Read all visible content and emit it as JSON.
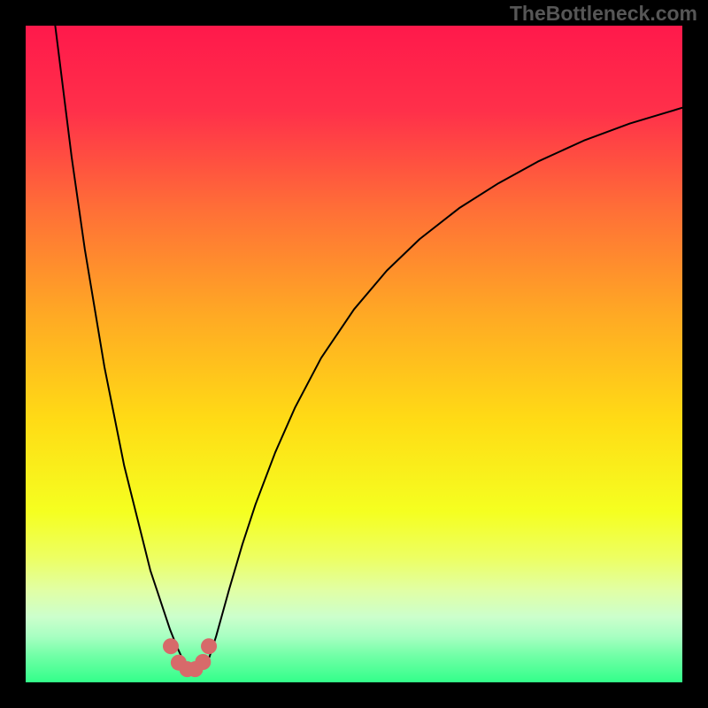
{
  "watermark": "TheBottleneck.com",
  "chart_data": {
    "type": "line",
    "title": "",
    "xlabel": "",
    "ylabel": "",
    "xlim": [
      0,
      100
    ],
    "ylim": [
      0,
      100
    ],
    "gradient_stops": [
      {
        "offset": 0.0,
        "color": "#ff194b"
      },
      {
        "offset": 0.13,
        "color": "#ff304a"
      },
      {
        "offset": 0.28,
        "color": "#ff6f37"
      },
      {
        "offset": 0.44,
        "color": "#ffa924"
      },
      {
        "offset": 0.6,
        "color": "#ffdb15"
      },
      {
        "offset": 0.74,
        "color": "#f5ff20"
      },
      {
        "offset": 0.81,
        "color": "#edff62"
      },
      {
        "offset": 0.86,
        "color": "#e1ffa5"
      },
      {
        "offset": 0.9,
        "color": "#ccffcc"
      },
      {
        "offset": 0.93,
        "color": "#a8ffc2"
      },
      {
        "offset": 0.96,
        "color": "#70ffa6"
      },
      {
        "offset": 1.0,
        "color": "#33ff8a"
      }
    ],
    "series": [
      {
        "name": "curve",
        "color": "#000000",
        "width": 2,
        "x": [
          4.5,
          5,
          6,
          7,
          8,
          9,
          10,
          11,
          12,
          13,
          14,
          15,
          16,
          17,
          18,
          19,
          20,
          21,
          22,
          23,
          24,
          25,
          26,
          27,
          28,
          29,
          30,
          31,
          33,
          35,
          38,
          41,
          45,
          50,
          55,
          60,
          66,
          72,
          78,
          85,
          92,
          100
        ],
        "y": [
          100,
          96,
          88,
          80,
          73,
          66,
          60,
          54,
          48,
          43,
          38,
          33,
          29,
          25,
          21,
          17,
          14,
          11,
          8,
          5.5,
          3.3,
          1.8,
          1.2,
          2.1,
          3.9,
          7.0,
          10.6,
          14.2,
          21.0,
          27.1,
          35.0,
          41.8,
          49.4,
          56.8,
          62.7,
          67.5,
          72.2,
          76.0,
          79.3,
          82.5,
          85.1,
          87.5
        ]
      },
      {
        "name": "marker-cluster",
        "color": "#d76a6a",
        "type": "scatter",
        "radius": 9,
        "x": [
          22.1,
          23.3,
          24.6,
          25.8,
          27.0,
          27.9
        ],
        "y": [
          5.5,
          3.0,
          2.0,
          2.0,
          3.1,
          5.5
        ]
      }
    ]
  }
}
